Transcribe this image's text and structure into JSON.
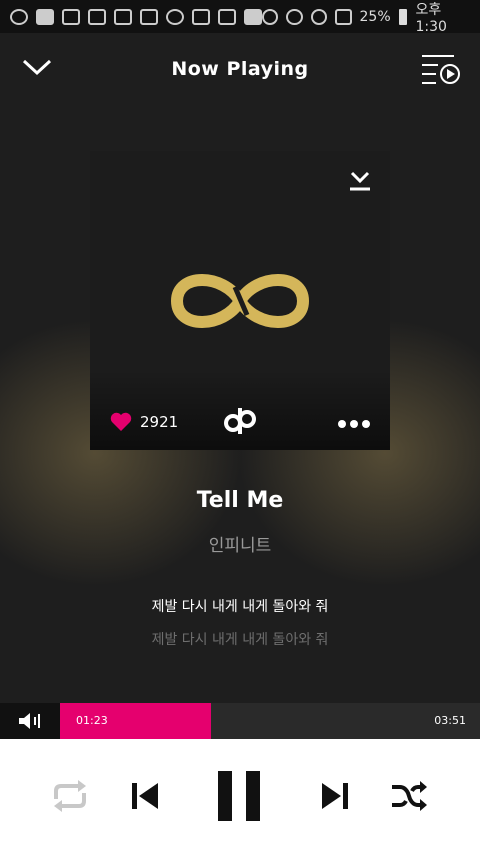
{
  "status_bar": {
    "battery": "25%",
    "time": "오후 1:30"
  },
  "header": {
    "title": "Now Playing"
  },
  "album": {
    "like_count": "2921"
  },
  "track": {
    "title": "Tell Me",
    "artist": "인피니트",
    "lyric_current": "제발 다시 내게 내게 돌아와 줘",
    "lyric_next": "제발 다시 내게 내게 돌아와 줘"
  },
  "player": {
    "current_time": "01:23",
    "total_time": "03:51",
    "progress": 0.36
  },
  "colors": {
    "accent": "#e5006e",
    "logo_gold": "#d4b65a",
    "repeat_inactive": "#c8c8c8"
  }
}
